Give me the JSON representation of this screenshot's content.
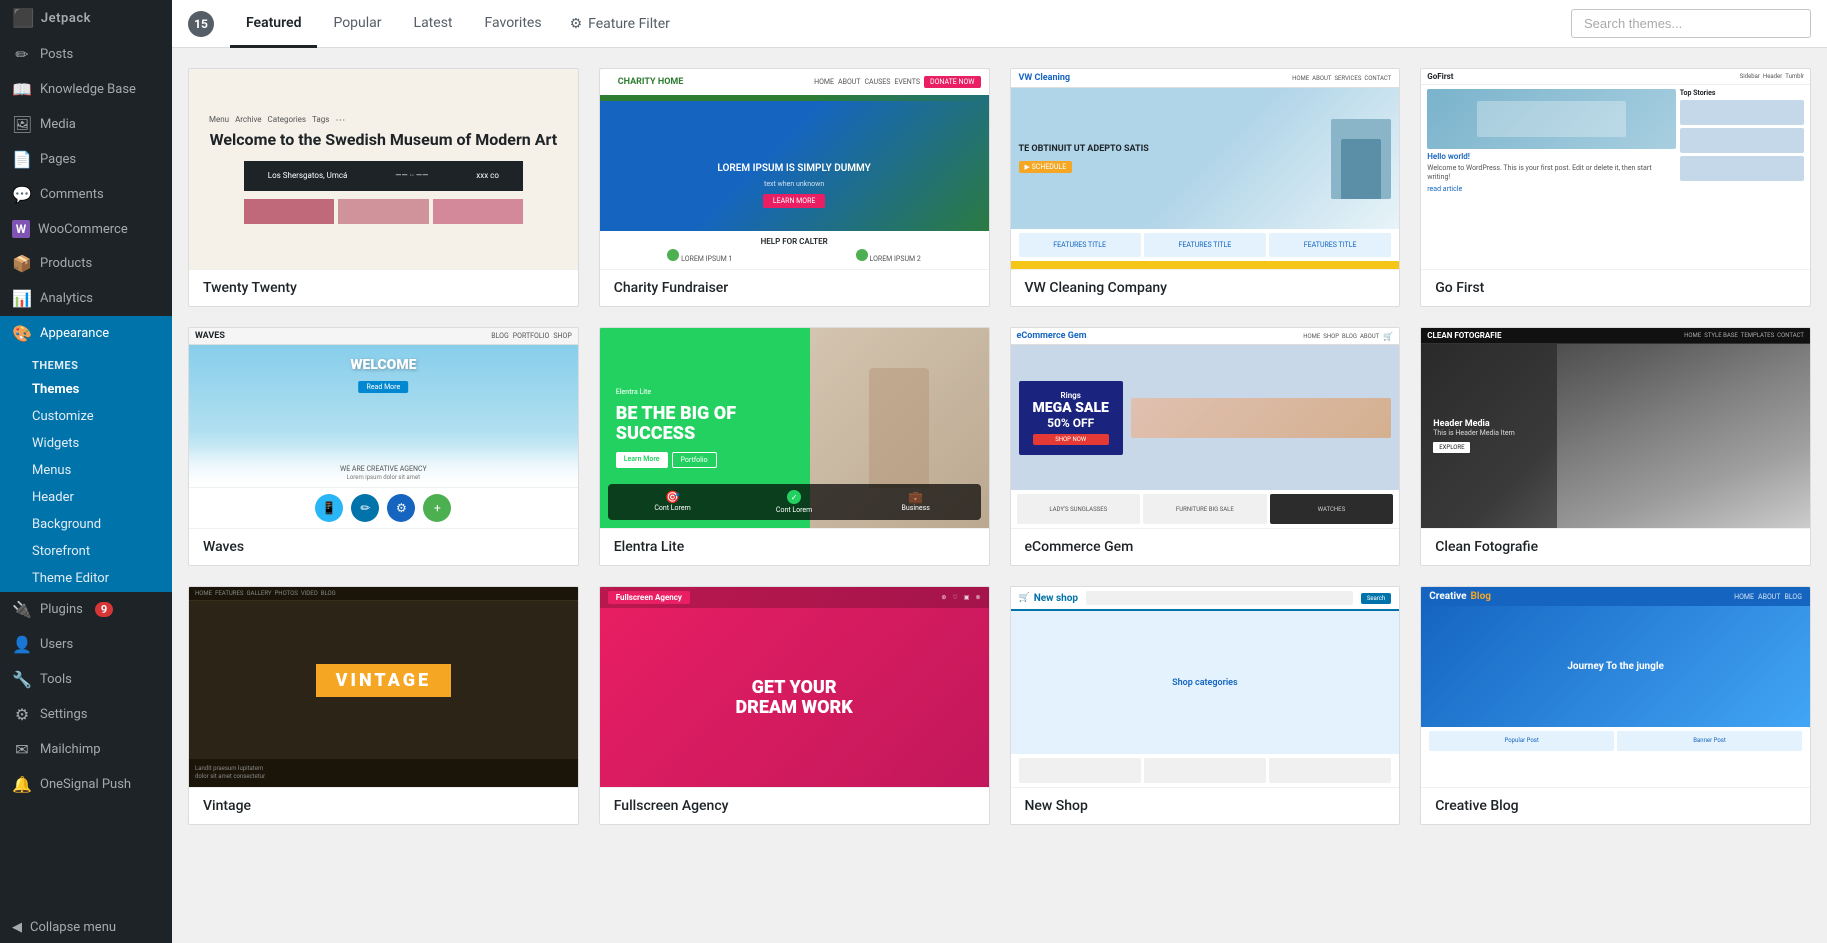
{
  "sidebar": {
    "brand": "Jetpack",
    "items": [
      {
        "id": "posts",
        "label": "Posts",
        "icon": "✏"
      },
      {
        "id": "knowledge-base",
        "label": "Knowledge Base",
        "icon": "📖"
      },
      {
        "id": "media",
        "label": "Media",
        "icon": "🖼"
      },
      {
        "id": "pages",
        "label": "Pages",
        "icon": "📄"
      },
      {
        "id": "comments",
        "label": "Comments",
        "icon": "💬"
      },
      {
        "id": "woocommerce",
        "label": "WooCommerce",
        "icon": "W"
      },
      {
        "id": "products",
        "label": "Products",
        "icon": "📦"
      },
      {
        "id": "analytics",
        "label": "Analytics",
        "icon": "📊"
      },
      {
        "id": "appearance",
        "label": "Appearance",
        "icon": "🎨",
        "active": true
      }
    ],
    "appearance_submenu": {
      "section_title": "Themes",
      "items": [
        {
          "id": "themes",
          "label": "Themes",
          "active": true
        },
        {
          "id": "customize",
          "label": "Customize"
        },
        {
          "id": "widgets",
          "label": "Widgets"
        },
        {
          "id": "menus",
          "label": "Menus"
        },
        {
          "id": "header",
          "label": "Header"
        },
        {
          "id": "background",
          "label": "Background"
        },
        {
          "id": "storefront",
          "label": "Storefront"
        },
        {
          "id": "theme-editor",
          "label": "Theme Editor"
        }
      ]
    },
    "more_items": [
      {
        "id": "plugins",
        "label": "Plugins",
        "icon": "🔌",
        "badge": "9"
      },
      {
        "id": "users",
        "label": "Users",
        "icon": "👤"
      },
      {
        "id": "tools",
        "label": "Tools",
        "icon": "🔧"
      },
      {
        "id": "settings",
        "label": "Settings",
        "icon": "⚙"
      },
      {
        "id": "mailchimp",
        "label": "Mailchimp",
        "icon": "✉"
      },
      {
        "id": "onesignal",
        "label": "OneSignal Push",
        "icon": "🔔"
      }
    ],
    "collapse_label": "Collapse menu"
  },
  "tabs": {
    "count": 15,
    "items": [
      {
        "id": "featured",
        "label": "Featured",
        "active": true
      },
      {
        "id": "popular",
        "label": "Popular"
      },
      {
        "id": "latest",
        "label": "Latest"
      },
      {
        "id": "favorites",
        "label": "Favorites"
      },
      {
        "id": "feature-filter",
        "label": "Feature Filter"
      }
    ],
    "search_placeholder": "Search themes..."
  },
  "themes": [
    {
      "id": "twenty-twenty",
      "name": "Twenty Twenty",
      "type": "twenty-twenty"
    },
    {
      "id": "charity-fundraiser",
      "name": "Charity Fundraiser",
      "type": "charity"
    },
    {
      "id": "vw-cleaning",
      "name": "VW Cleaning Company",
      "type": "vwcleaning"
    },
    {
      "id": "go-first",
      "name": "Go First",
      "type": "gofirst"
    },
    {
      "id": "waves",
      "name": "Waves",
      "type": "waves"
    },
    {
      "id": "elentra-lite",
      "name": "Elentra Lite",
      "type": "elentra"
    },
    {
      "id": "ecommerce-gem",
      "name": "eCommerce Gem",
      "type": "ecommerce"
    },
    {
      "id": "clean-fotografie",
      "name": "Clean Fotografie",
      "type": "cleanfoto"
    },
    {
      "id": "vintage",
      "name": "Vintage",
      "type": "vintage"
    },
    {
      "id": "fullscreen-agency",
      "name": "Fullscreen Agency",
      "type": "fullscreen"
    },
    {
      "id": "new-shop",
      "name": "New Shop",
      "type": "newshop"
    },
    {
      "id": "creative-blog",
      "name": "Creative Blog",
      "type": "creativeblog"
    }
  ]
}
